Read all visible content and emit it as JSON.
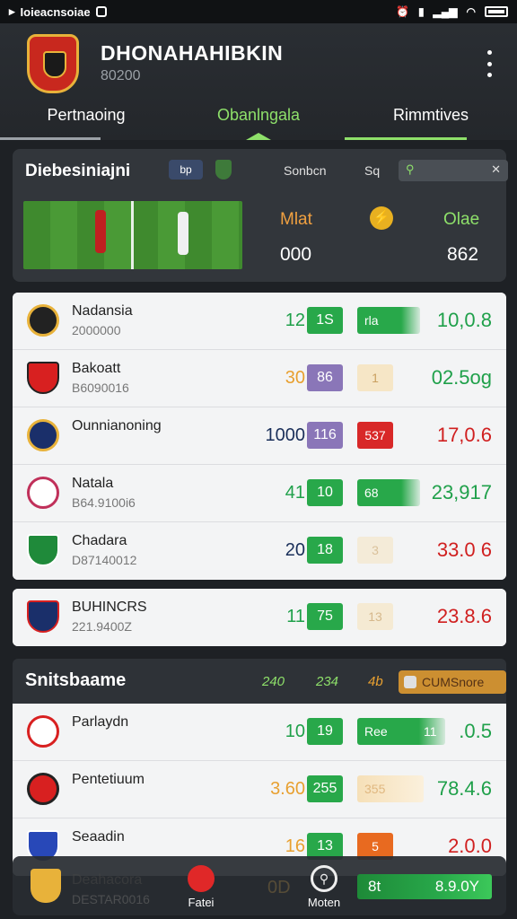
{
  "status_bar": {
    "left_text": "Ioieacnsoiae",
    "icon_mid": "e"
  },
  "header": {
    "title": "DHONAHAHIBKIN",
    "subtitle": "80200",
    "tabs": [
      {
        "label": "Pertnaoing"
      },
      {
        "label": "Obanlngala"
      },
      {
        "label": "Rimmtives"
      }
    ]
  },
  "live_panel": {
    "title": "Diebesiniajni",
    "tag": "bp",
    "sort_label": "Sonbcn",
    "sort_icon": "Sq",
    "team_a_label": "Mlat",
    "team_b_label": "Olae",
    "team_a_value": "000",
    "team_b_value": "862"
  },
  "rows_group1": [
    {
      "name": "Nadansia",
      "sub": "2000000",
      "num": "12",
      "badge": "1S",
      "bar": "rla",
      "value": "10,0.8",
      "color": "#1fa04a"
    },
    {
      "name": "Bakoatt",
      "sub": "B6090016",
      "num": "30",
      "badge": "86",
      "bar": "1",
      "value": "02.5og",
      "color": "#1fa04a"
    },
    {
      "name": "Ounnianoning",
      "sub": "",
      "num": "1000",
      "badge": "116",
      "bar": "537",
      "value": "17,0.6",
      "color": "#d02020"
    },
    {
      "name": "Natala",
      "sub": "B64.9100i6",
      "num": "41",
      "badge": "10",
      "bar": "68",
      "value": "23,917",
      "color": "#1fa04a"
    },
    {
      "name": "Chadara",
      "sub": "D87140012",
      "num": "20",
      "badge": "18",
      "bar": "3",
      "value": "33.0 6",
      "color": "#d02020"
    }
  ],
  "row_single": {
    "name": "BUHINCRS",
    "sub": "221.9400Z",
    "num": "11",
    "badge": "75",
    "bar": "13",
    "value": "23.8.6"
  },
  "section2": {
    "title": "Snitsbaame",
    "col1": "240",
    "col2": "234",
    "col3": "4b",
    "pill": "CUMSnore"
  },
  "rows_group2": [
    {
      "name": "Parlaydn",
      "sub": "",
      "num": "10",
      "badge": "19",
      "bar": "Ree",
      "bar2": "11",
      "value": ".0.5",
      "color": "#1fa04a"
    },
    {
      "name": "Pentetiuum",
      "sub": "",
      "num": "3.60",
      "badge": "255",
      "bar": "355",
      "value": "78.4.6",
      "color": "#1fa04a"
    },
    {
      "name": "Seaadin",
      "sub": "",
      "num": "16",
      "badge": "13",
      "bar": "5",
      "value": "2.0.0",
      "color": "#d02020"
    }
  ],
  "bottom_bar": {
    "name": "Deahacora",
    "sub": "DESTAR0016",
    "num": "0D",
    "nav1_label": "Fatei",
    "nav2_label": "Moten",
    "pill_left": "8t",
    "pill_right": "8.9.0Y"
  },
  "colors": {
    "accent_green": "#8ee06a",
    "badge_green": "#28a84a",
    "red": "#d82828",
    "orange": "#e8a030"
  }
}
